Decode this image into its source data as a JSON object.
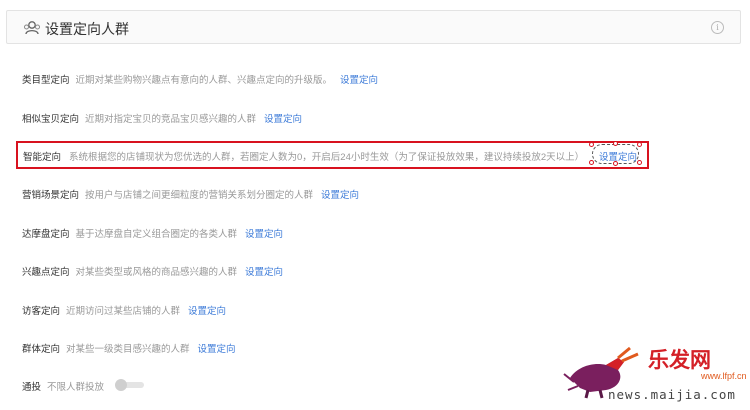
{
  "header": {
    "title": "设置定向人群",
    "info_icon": "i"
  },
  "options": [
    {
      "label": "类目型定向",
      "desc": "近期对某些购物兴趣点有意向的人群、兴趣点定向的升级版。",
      "link": "设置定向"
    },
    {
      "label": "相似宝贝定向",
      "desc": "近期对指定宝贝的竞品宝贝感兴趣的人群",
      "link": "设置定向"
    },
    {
      "label": "智能定向",
      "desc": "系统根据您的店铺现状为您优选的人群，若圈定人数为0，开启后24小时生效（为了保证投放效果，建议持续投放2天以上）",
      "link": "设置定向"
    },
    {
      "label": "营销场景定向",
      "desc": "按用户与店铺之间更细粒度的营销关系划分圈定的人群",
      "link": "设置定向"
    },
    {
      "label": "达摩盘定向",
      "desc": "基于达摩盘自定义组合圈定的各类人群",
      "link": "设置定向"
    },
    {
      "label": "兴趣点定向",
      "desc": "对某些类型或风格的商品感兴趣的人群",
      "link": "设置定向"
    },
    {
      "label": "访客定向",
      "desc": "近期访问过某些店铺的人群",
      "link": "设置定向"
    },
    {
      "label": "群体定向",
      "desc": "对某些一级类目感兴趣的人群",
      "link": "设置定向"
    }
  ],
  "general": {
    "label": "通投",
    "desc": "不限人群投放",
    "enabled": false
  },
  "watermark": {
    "brand": "乐发网",
    "small_url": "www.lfpf.cn",
    "url": "news.maijia.com"
  },
  "colors": {
    "link": "#3d7bd8",
    "highlight": "#d8121f"
  }
}
